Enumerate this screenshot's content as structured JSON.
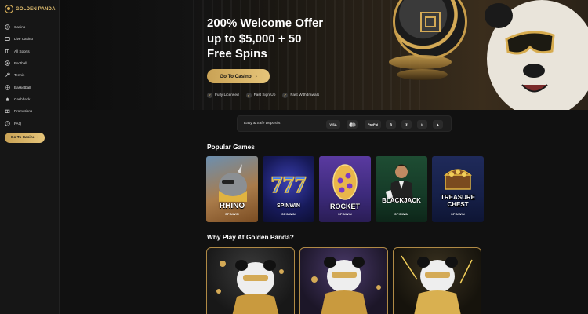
{
  "brand": {
    "name": "GOLDEN PANDA"
  },
  "sidebar": {
    "items": [
      {
        "label": "Casino",
        "icon": "casino-chip-icon"
      },
      {
        "label": "Live Casino",
        "icon": "live-casino-icon"
      },
      {
        "label": "All Sports",
        "icon": "sports-icon"
      },
      {
        "label": "Football",
        "icon": "football-icon"
      },
      {
        "label": "Tennis",
        "icon": "tennis-icon"
      },
      {
        "label": "Basketball",
        "icon": "basketball-icon"
      },
      {
        "label": "Cashback",
        "icon": "cashback-icon"
      },
      {
        "label": "Promotions",
        "icon": "promotions-icon"
      },
      {
        "label": "FAQ",
        "icon": "faq-icon"
      }
    ],
    "cta_label": "Go To Casino"
  },
  "hero": {
    "title_line1": "200% Welcome Offer",
    "title_line2": "up to $5,000 + 50",
    "title_line3": "Free Spins",
    "cta_label": "Go To Casino",
    "badges": [
      "Fully Licensed",
      "Fast Sign Up",
      "Fast Withdrawals"
    ]
  },
  "deposits": {
    "label": "Easy & Safe Deposits",
    "methods": [
      "VISA",
      "mastercard-icon",
      "PayPal",
      "bitcoin-icon",
      "tether-icon",
      "litecoin-icon",
      "tron-icon"
    ]
  },
  "popular": {
    "title": "Popular Games",
    "games": [
      {
        "name": "RHINO",
        "brand": "SPINWIN"
      },
      {
        "name": "SPINWIN",
        "brand": "SPINWIN"
      },
      {
        "name": "ROCKET",
        "brand": "SPINWIN"
      },
      {
        "name": "BLACKJACK",
        "brand": "SPINWIN"
      },
      {
        "name_line1": "TREASURE",
        "name_line2": "CHEST",
        "brand": "SPINWIN"
      }
    ]
  },
  "why": {
    "title": "Why Play At Golden Panda?"
  },
  "colors": {
    "gold": "#d9b15c",
    "background": "#111111",
    "sidebar": "#161616"
  }
}
